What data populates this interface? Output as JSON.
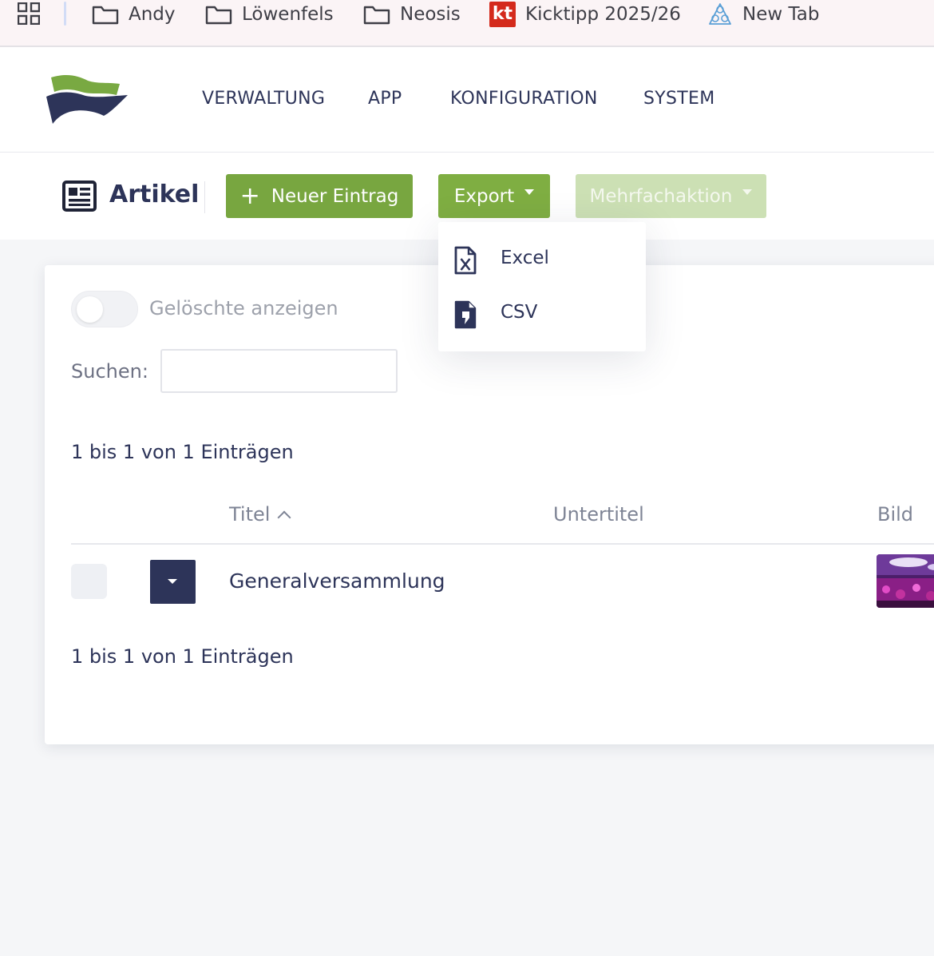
{
  "bookmarks": {
    "items": [
      {
        "label": "Andy",
        "icon": "folder-icon"
      },
      {
        "label": "Löwenfels",
        "icon": "folder-icon"
      },
      {
        "label": "Neosis",
        "icon": "folder-icon"
      },
      {
        "label": "Kicktipp 2025/26",
        "icon": "kicktipp-icon",
        "icon_text": "kt"
      },
      {
        "label": "New Tab",
        "icon": "newtab-icon"
      }
    ]
  },
  "nav": {
    "items": [
      "VERWALTUNG",
      "APP",
      "KONFIGURATION",
      "SYSTEM"
    ]
  },
  "toolbar": {
    "title": "Artikel",
    "title_icon": "newspaper-icon",
    "new_label": "Neuer Eintrag",
    "new_icon": "+",
    "export_label": "Export",
    "multi_label": "Mehrfachaktion"
  },
  "export_menu": {
    "items": [
      {
        "label": "Excel",
        "icon": "excel-file-icon"
      },
      {
        "label": "CSV",
        "icon": "csv-file-icon"
      }
    ]
  },
  "filters": {
    "show_deleted_label": "Gelöschte anzeigen",
    "show_deleted_on": false,
    "search_label": "Suchen:",
    "search_value": ""
  },
  "table": {
    "info_top": "1 bis 1 von 1 Einträgen",
    "info_bottom": "1 bis 1 von 1 Einträgen",
    "columns": [
      "Titel",
      "Untertitel",
      "Bild"
    ],
    "rows": [
      {
        "title": "Generalversammlung",
        "subtitle": ""
      }
    ]
  },
  "colors": {
    "primary": "#2d3459",
    "green": "#7fae42",
    "green_disabled": "#cce0b4",
    "kicktipp_red": "#d42a1c"
  }
}
